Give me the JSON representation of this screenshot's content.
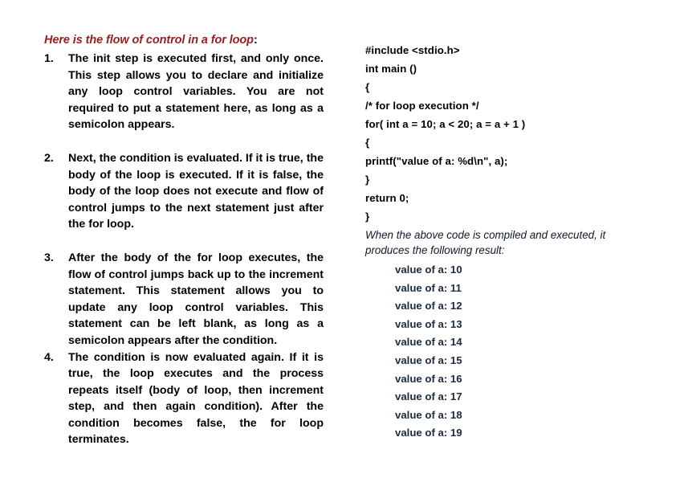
{
  "document": {
    "background_color": "#ffffff",
    "heading_color": "#9C1C1C",
    "body_color": "#000000",
    "output_color": "#1C2A3E"
  },
  "left_column": {
    "heading_text": "Here is the flow of control in a for loop",
    "heading_colon": ":",
    "items": [
      {
        "marker": "1.",
        "text": "The init step is executed first, and only once. This step allows you to declare and initialize any loop control variables. You are not required to put a statement here, as long as a semicolon appears."
      },
      {
        "marker": "2.",
        "text": "Next, the condition is evaluated. If it is true, the body of the loop is executed. If it is false, the body of the loop does not execute and flow of control jumps to the next statement just after the for loop."
      },
      {
        "marker": "3.",
        "text": "After the body of the for loop executes, the flow of control jumps back up to the increment statement. This statement allows you to update any loop control variables. This statement can be left blank, as long as a semicolon appears after the condition."
      },
      {
        "marker": "4.",
        "text": "The condition is now evaluated again. If it is true, the loop executes and the process repeats itself (body of loop, then increment step, and then again condition). After the condition becomes false, the for loop terminates."
      }
    ]
  },
  "right_column": {
    "code_lines": [
      "#include <stdio.h>",
      "int main ()",
      "{",
      "/* for loop execution */",
      "for( int a = 10; a < 20; a = a + 1 )",
      "{",
      "printf(\"value of a: %d\\n\", a);",
      "}",
      "return 0;",
      "}"
    ],
    "result_note": "When the above code is compiled and executed, it produces the following result:",
    "output_lines": [
      "value of a: 10",
      "value of a: 11",
      "value of a: 12",
      "value of a: 13",
      "value of a: 14",
      "value of a: 15",
      "value of a: 16",
      "value of a: 17",
      "value of a: 18",
      "value of a: 19"
    ]
  }
}
